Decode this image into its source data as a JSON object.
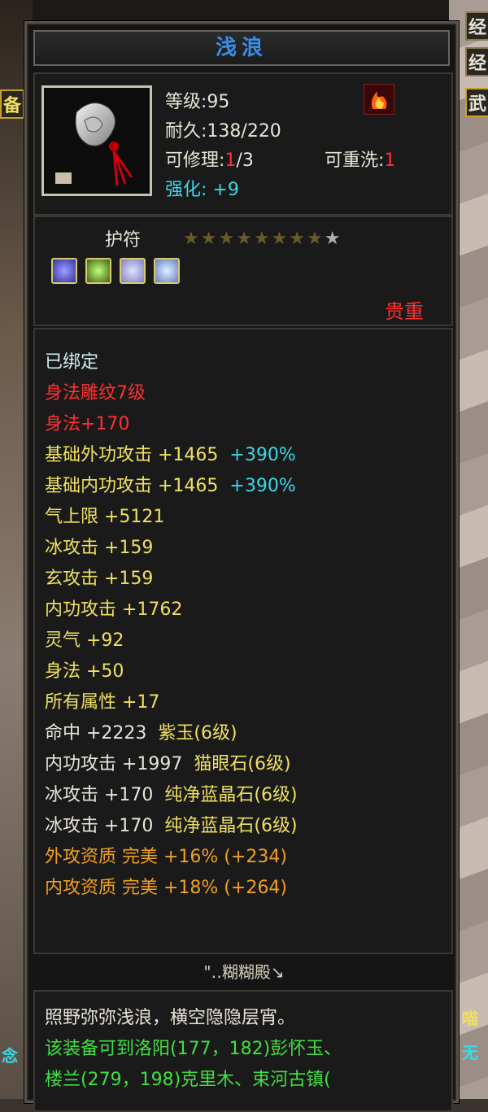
{
  "item": {
    "name": "浅浪",
    "level": "等级:95",
    "durability": "耐久:138/220",
    "repair_label": "可修理:",
    "repair_value": "1",
    "repair_total": "/3",
    "rewash_label": "可重洗:",
    "rewash_value": "1",
    "enhance_label": "强化:",
    "enhance_value": "+9",
    "type": "护符",
    "stars_total": 9,
    "stars_filled": 8,
    "quality": "贵重"
  },
  "attributes": [
    {
      "text": "已绑定",
      "color": "pale"
    },
    {
      "text": "身法雕纹7级",
      "color": "red"
    },
    {
      "text": "身法+170",
      "color": "red"
    },
    {
      "text": "基础外功攻击 +1465",
      "extra": "+390%",
      "color": "yellow"
    },
    {
      "text": "基础内功攻击 +1465",
      "extra": "+390%",
      "color": "yellow"
    },
    {
      "text": "气上限 +5121",
      "color": "yellow"
    },
    {
      "text": "冰攻击 +159",
      "color": "yellow"
    },
    {
      "text": "玄攻击 +159",
      "color": "yellow"
    },
    {
      "text": "内功攻击 +1762",
      "color": "yellow"
    },
    {
      "text": "灵气 +92",
      "color": "yellow"
    },
    {
      "text": "身法 +50",
      "color": "yellow"
    },
    {
      "text": "所有属性 +17",
      "color": "yellow"
    },
    {
      "text": "命中 +2223",
      "extra": "紫玉(6级)",
      "color": "white"
    },
    {
      "text": "内功攻击 +1997",
      "extra": "猫眼石(6级)",
      "color": "white"
    },
    {
      "text": "冰攻击 +170",
      "extra": "纯净蓝晶石(6级)",
      "color": "white"
    },
    {
      "text": "冰攻击 +170",
      "extra": "纯净蓝晶石(6级)",
      "color": "white"
    },
    {
      "text": "外攻资质  完美 +16% (+234)",
      "color": "orange"
    },
    {
      "text": "内攻资质  完美 +18% (+264)",
      "color": "orange"
    }
  ],
  "signature": "\"‥糊糊殿↘",
  "description": {
    "line1": "照野弥弥浅浪，横空隐隐层宵。",
    "line2": "该装备可到洛阳(177，182)彭怀玉、",
    "line3": "楼兰(279，198)克里木、束河古镇("
  },
  "edge": {
    "top_left": "",
    "right_1": "经",
    "right_2": "经",
    "left_1": "备",
    "right_3": "武",
    "bottom_right_1": "喵",
    "bottom_right_2": "无",
    "bottom_left": "念"
  },
  "colors": {
    "title": "#3a8ee8",
    "red": "#ff3030",
    "cyan": "#3ad8e8",
    "yellow": "#f0e060",
    "orange": "#f0a020"
  }
}
